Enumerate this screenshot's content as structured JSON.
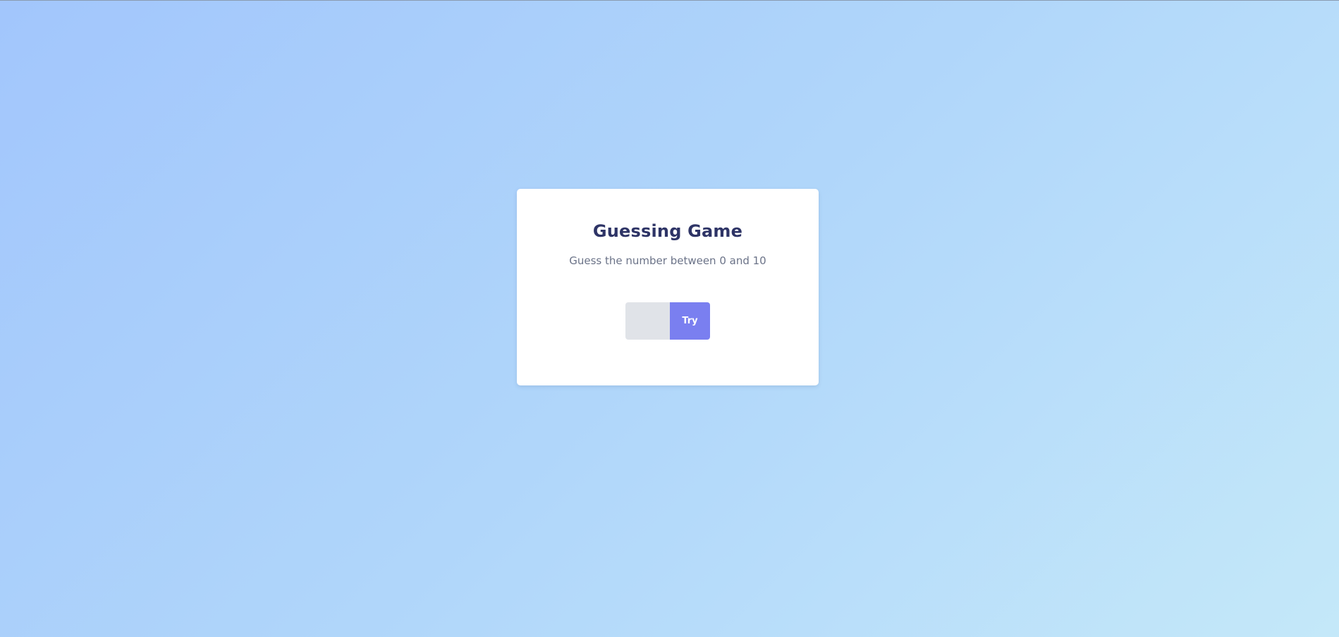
{
  "game": {
    "title": "Guessing Game",
    "subtitle": "Guess the number between 0 and 10",
    "guess_value": "",
    "guess_placeholder": "",
    "try_label": "Try"
  },
  "colors": {
    "background_start": "#a2c6fc",
    "background_end": "#c4e8f9",
    "card": "#ffffff",
    "title": "#2e3466",
    "subtitle": "#6b7388",
    "input_bg": "#e0e3e8",
    "accent": "#7a7ff0"
  }
}
